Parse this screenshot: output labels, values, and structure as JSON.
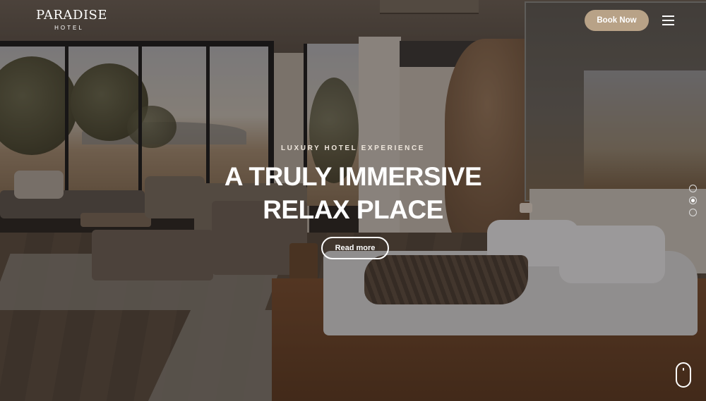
{
  "brand": {
    "name": "PARADISE",
    "subtitle": "HOTEL"
  },
  "header": {
    "book_label": "Book Now",
    "menu_icon": "hamburger-menu-icon"
  },
  "hero": {
    "eyebrow": "LUXURY HOTEL EXPERIENCE",
    "headline_line1": "A TRULY IMMERSIVE",
    "headline_line2": "RELAX PLACE",
    "cta_label": "Read more",
    "background": "hotel suite with bed, sofa and desert view windows"
  },
  "slider": {
    "slide_count": 3,
    "active_index": 1
  },
  "scroll_indicator": {
    "icon": "mouse-scroll-icon"
  },
  "colors": {
    "accent": "#b8a287",
    "text": "#ffffff",
    "overlay": "rgba(20,16,13,0.38)"
  }
}
